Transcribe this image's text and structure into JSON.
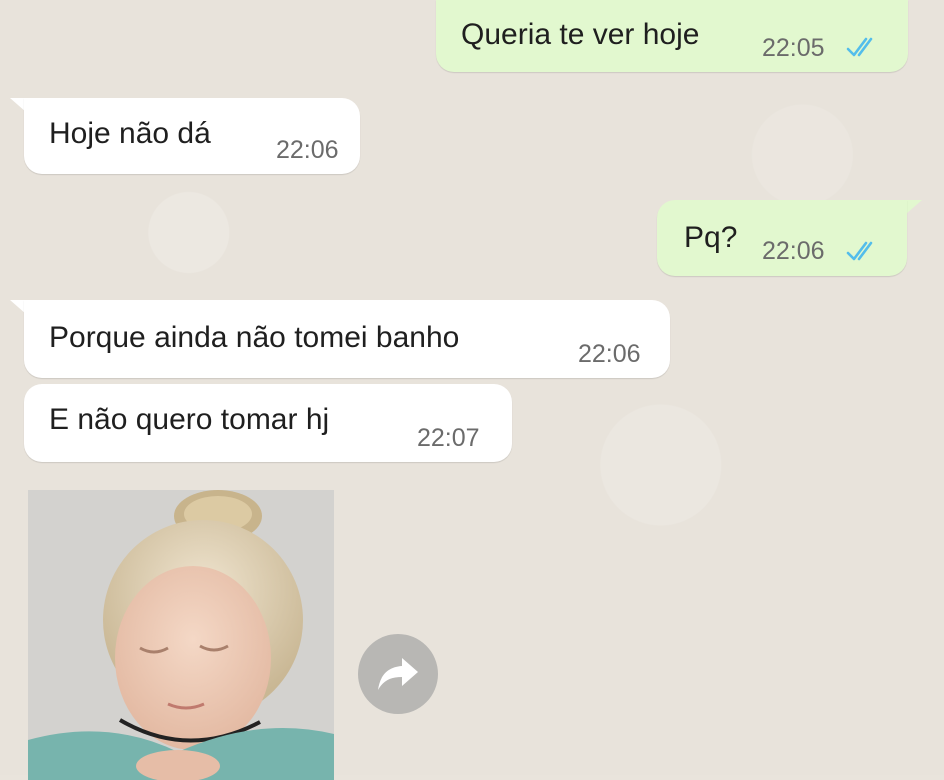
{
  "messages": [
    {
      "id": "m1",
      "direction": "outgoing",
      "text": "Queria te ver hoje",
      "time": "22:05",
      "status": "read"
    },
    {
      "id": "m2",
      "direction": "incoming",
      "text": "Hoje não dá",
      "time": "22:06"
    },
    {
      "id": "m3",
      "direction": "outgoing",
      "text": "Pq?",
      "time": "22:06",
      "status": "read"
    },
    {
      "id": "m4",
      "direction": "incoming",
      "text": "Porque ainda não tomei banho",
      "time": "22:06"
    },
    {
      "id": "m5",
      "direction": "incoming",
      "text": "E não quero tomar hj",
      "time": "22:07"
    }
  ],
  "image_message": {
    "direction": "incoming",
    "type": "photo"
  },
  "icons": {
    "read_ticks": "double-check-icon",
    "forward": "forward-arrow-icon"
  },
  "colors": {
    "outgoing_bubble": "#e2f8cf",
    "incoming_bubble": "#ffffff",
    "background": "#e8e3db",
    "read_ticks": "#53bdeb",
    "time_text": "#6b6b6b",
    "forward_button": "#b8b7b4"
  }
}
